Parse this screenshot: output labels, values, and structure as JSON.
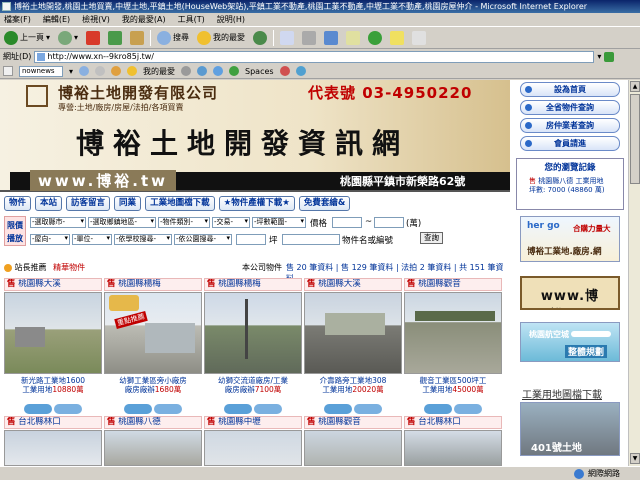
{
  "window": {
    "title": "博裕土地開發,桃園土地買賣,中壢土地,平鎮土地(HouseWeb架站),平鎮工業不動產,桃園工業不動產,中壢工業不動產,桃園房屋仲介 - Microsoft Internet Explorer"
  },
  "menu": [
    "檔案(F)",
    "編輯(E)",
    "檢視(V)",
    "我的最愛(A)",
    "工具(T)",
    "說明(H)"
  ],
  "toolbar": {
    "back": "上一頁",
    "search": "搜尋",
    "favorites": "我的最愛"
  },
  "address": {
    "label": "網址(D)",
    "url": "http://www.xn--9kro85j.tw/"
  },
  "search_toolbar": {
    "value": "nownews",
    "favorites": "我的最愛",
    "spaces": "Spaces"
  },
  "banner": {
    "company": "博裕土地開發有限公司",
    "business": "專營:土地/廠房/房屋/法拍/各項買賣",
    "phone": "代表號 03-4950220",
    "title": "博裕土地開發資訊網",
    "domain": "www.博裕.tw",
    "address": "桃園縣平鎮市新榮路62號"
  },
  "nav": [
    "物件",
    "本站",
    "訪客留言",
    "同業",
    "工業地圖檔下載",
    "★物件產權下載★",
    "免費套繪&"
  ],
  "filter": {
    "label": "限價播放",
    "row1": [
      "-選取縣市-",
      "-選取鄉鎮地區-",
      "-物件類別-",
      "-交易-",
      "-坪數範圍-"
    ],
    "price_label": "價格",
    "tilde": "~",
    "unit": "(萬)",
    "row2": [
      "-屋向-",
      "-單位-",
      "-依學校搜尋-",
      "-依公園搜尋-"
    ],
    "ping": "坪",
    "name_label": "物件名或編號",
    "query": "查詢"
  },
  "recommend": {
    "label": "站長推薦",
    "featured": "精華物件",
    "stats_prefix": "本公司物件",
    "stats": "售 20 筆資料 | 售 129 筆資料 | 法拍 2 筆資料 | 共 151 筆資料"
  },
  "listings_row1": [
    {
      "tag": "售",
      "loc": "桃園縣大溪"
    },
    {
      "tag": "售",
      "loc": "桃園縣楊梅"
    },
    {
      "tag": "售",
      "loc": "桃園縣楊梅"
    },
    {
      "tag": "售",
      "loc": "桃園縣大溪"
    },
    {
      "tag": "售",
      "loc": "桃園縣觀音"
    }
  ],
  "captions_row1": [
    {
      "line1": "新光路工業地1600",
      "line2": "工業用地",
      "price": "10880萬"
    },
    {
      "line1": "幼獅工業區旁小廠房",
      "line2": "廠房廠辦",
      "price": "1680萬"
    },
    {
      "line1": "幼獅交流道廠房/工業",
      "line2": "廠房廠辦",
      "price": "7100萬"
    },
    {
      "line1": "介壽路旁工業地308",
      "line2": "工業用地",
      "price": "20020萬"
    },
    {
      "line1": "觀音工業區500坪工",
      "line2": "工業用地",
      "price": "45000萬"
    }
  ],
  "hot_badge": "重點推薦",
  "listings_row2": [
    {
      "tag": "售",
      "loc": "台北縣林口"
    },
    {
      "tag": "售",
      "loc": "桃園縣八德"
    },
    {
      "tag": "售",
      "loc": "桃園縣中壢"
    },
    {
      "tag": "售",
      "loc": "桃園縣觀音"
    },
    {
      "tag": "售",
      "loc": "台北縣林口"
    }
  ],
  "sidebar": {
    "buttons": [
      "設為首頁",
      "全省物件查詢",
      "房仲業者查詢",
      "會員請進"
    ],
    "visit_title": "您的瀏覽記錄",
    "visit_tag": "售",
    "visit_item": "桃園縣八德 工業用地",
    "visit_size": "坪數: 7000 (48860 萬)",
    "ad1_top": "合購力量大",
    "ad1_bottom": "博裕工業地.廠房.網",
    "ad2": "www.博裕.tw",
    "ad3_top": "桃園航空城",
    "ad3_bottom": "整體規劃",
    "ad4": "工業用地圖檔下載",
    "ad5": "401號土地"
  },
  "status": "網際網路"
}
